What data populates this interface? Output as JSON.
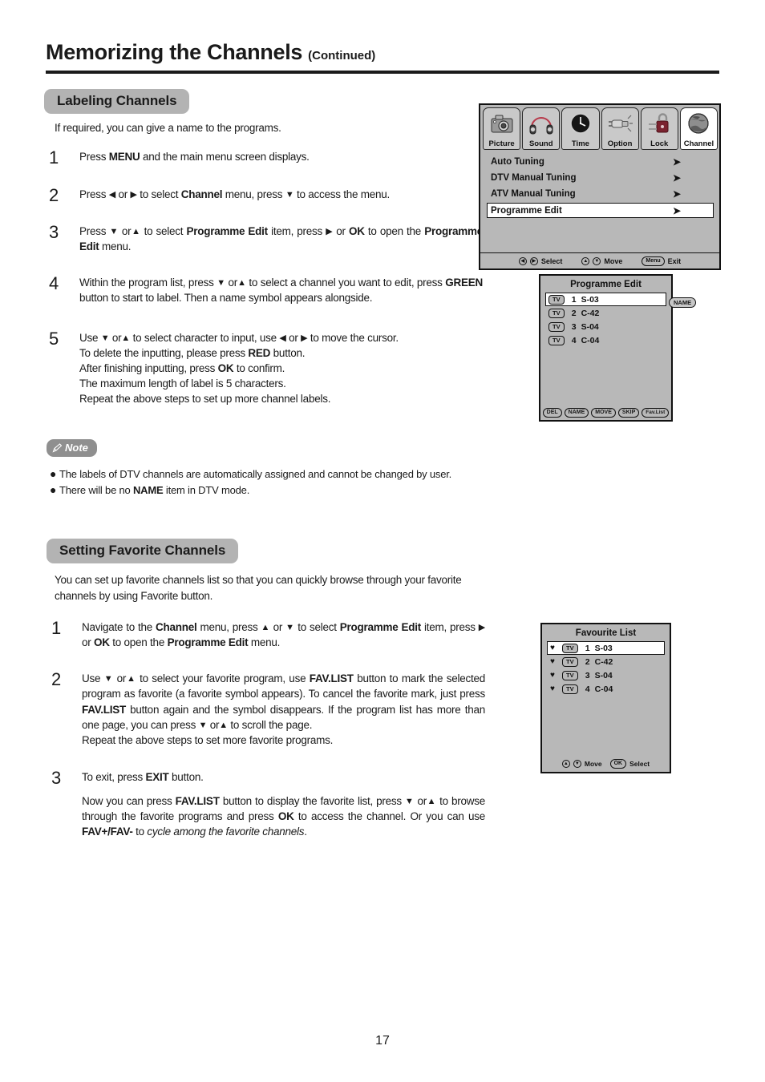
{
  "header": {
    "title": "Memorizing the Channels",
    "continued": "(Continued)"
  },
  "sections": {
    "labeling": {
      "banner": "Labeling Channels",
      "intro": "If required, you can give a name to the programs.",
      "steps": [
        {
          "num": "1",
          "html": "Press <b>MENU</b> and the main menu screen displays."
        },
        {
          "num": "2",
          "html": "Press <span class=\"arr\">◀</span> or <span class=\"arr\">▶</span> to select <b>Channel</b> menu,  press <span class=\"arr\">▼</span> to access the menu."
        },
        {
          "num": "3",
          "html": "Press <span class=\"arr\">▼</span> or<span class=\"arr\">▲</span> to select <b>Programme Edit</b> item, press <span class=\"arr\">▶</span> or <b>OK</b> to open the <b>Programme Edit</b> menu."
        },
        {
          "num": "4",
          "html": "Within the program list,  press <span class=\"arr\">▼</span> or<span class=\"arr\">▲</span> to select a channel you want to edit, press <b>GREEN</b> button to start to label. Then a name symbol appears alongside."
        },
        {
          "num": "5",
          "html": "Use <span class=\"arr\">▼</span> or<span class=\"arr\">▲</span> to select character to input, use <span class=\"arr\">◀</span> or <span class=\"arr\">▶</span> to move the cursor.<br>To delete the inputting, please press <b>RED</b> button.<br>After finishing inputting, press <b>OK</b> to confirm.<br>The maximum length of label is 5 characters.<br>Repeat the above steps to set up more channel labels."
        }
      ],
      "note_label": "Note",
      "notes": [
        "The labels of DTV channels are automatically assigned and cannot be changed by user.",
        "There will be no <b>NAME</b> item in DTV mode."
      ]
    },
    "favorite": {
      "banner": "Setting Favorite Channels",
      "intro": "You can set up favorite channels list so that you can quickly browse through your favorite channels by using Favorite button.",
      "steps": [
        {
          "num": "1",
          "html": "Navigate to the <b>Channel</b> menu,  press <span class=\"arr\">▲</span> or <span class=\"arr\">▼</span> to select <b>Programme Edit</b> item, press <span class=\"arr\">▶</span> or <b>OK</b> to open the <b>Programme Edit</b> menu."
        },
        {
          "num": "2",
          "html": "Use <span class=\"arr\">▼</span> or<span class=\"arr\">▲</span> to select your favorite program, use <b>FAV.LIST</b> button to mark the selected program as favorite (a favorite symbol appears). To cancel the favorite mark, just press <b>FAV.LIST</b> button again and the symbol disappears. If the program list has more than one page, you can press <span class=\"arr\">▼</span> or<span class=\"arr\">▲</span> to scroll the page.<br>Repeat the above steps to set more favorite programs."
        },
        {
          "num": "3",
          "html": "To exit, press <b>EXIT</b> button."
        },
        {
          "num": "",
          "html": "Now you can press <b>FAV.LIST</b> button to display the favorite list, press <span class=\"arr\">▼</span> or<span class=\"arr\">▲</span> to browse through the favorite programs and press <b>OK</b> to access the channel. Or you can use <b>FAV+/FAV-</b> to <span class=\"ital\">cycle among the favorite channels</span>."
        }
      ]
    }
  },
  "osd_main": {
    "tabs": [
      {
        "label": "Picture",
        "icon": "camera-icon",
        "active": false
      },
      {
        "label": "Sound",
        "icon": "headphones-icon",
        "active": false
      },
      {
        "label": "Time",
        "icon": "clock-icon",
        "active": false
      },
      {
        "label": "Option",
        "icon": "plug-icon",
        "active": false
      },
      {
        "label": "Lock",
        "icon": "padlock-icon",
        "active": false
      },
      {
        "label": "Channel",
        "icon": "globe-icon",
        "active": true
      }
    ],
    "items": [
      {
        "label": "Auto Tuning",
        "arrow": "➤",
        "selected": false
      },
      {
        "label": "DTV Manual Tuning",
        "arrow": "➤",
        "selected": false
      },
      {
        "label": "ATV Manual Tuning",
        "arrow": "➤",
        "selected": false
      },
      {
        "label": "Programme Edit",
        "arrow": "➤",
        "selected": true
      }
    ],
    "footer": [
      {
        "keys": "◀▶",
        "label": "Select"
      },
      {
        "keys": "▲▼",
        "label": "Move"
      },
      {
        "cap": "Menu",
        "label": "Exit"
      }
    ]
  },
  "osd_progedit": {
    "title": "Programme Edit",
    "rows": [
      {
        "tag": "TV",
        "no": "1",
        "name": "S-03",
        "selected": true
      },
      {
        "tag": "TV",
        "no": "2",
        "name": "C-42",
        "selected": false
      },
      {
        "tag": "TV",
        "no": "3",
        "name": "S-04",
        "selected": false
      },
      {
        "tag": "TV",
        "no": "4",
        "name": "C-04",
        "selected": false
      }
    ],
    "name_badge": "NAME",
    "buttons": [
      "DEL",
      "NAME",
      "MOVE",
      "SKIP",
      "Fav.List"
    ]
  },
  "osd_favlist": {
    "title": "Favourite List",
    "rows": [
      {
        "heart": "♥",
        "tag": "TV",
        "no": "1",
        "name": "S-03",
        "selected": true
      },
      {
        "heart": "♥",
        "tag": "TV",
        "no": "2",
        "name": "C-42",
        "selected": false
      },
      {
        "heart": "♥",
        "tag": "TV",
        "no": "3",
        "name": "S-04",
        "selected": false
      },
      {
        "heart": "♥",
        "tag": "TV",
        "no": "4",
        "name": "C-04",
        "selected": false
      }
    ],
    "footer": [
      {
        "keys": "▲▼",
        "label": "Move"
      },
      {
        "cap": "OK",
        "label": "Select"
      }
    ]
  },
  "page_number": "17",
  "colors": {
    "banner_bg": "#b3b3b3",
    "note_bg": "#8f8f8f",
    "osd_bg": "#b8b8b8",
    "osd_border": "#111111",
    "text": "#1a1a1a"
  }
}
